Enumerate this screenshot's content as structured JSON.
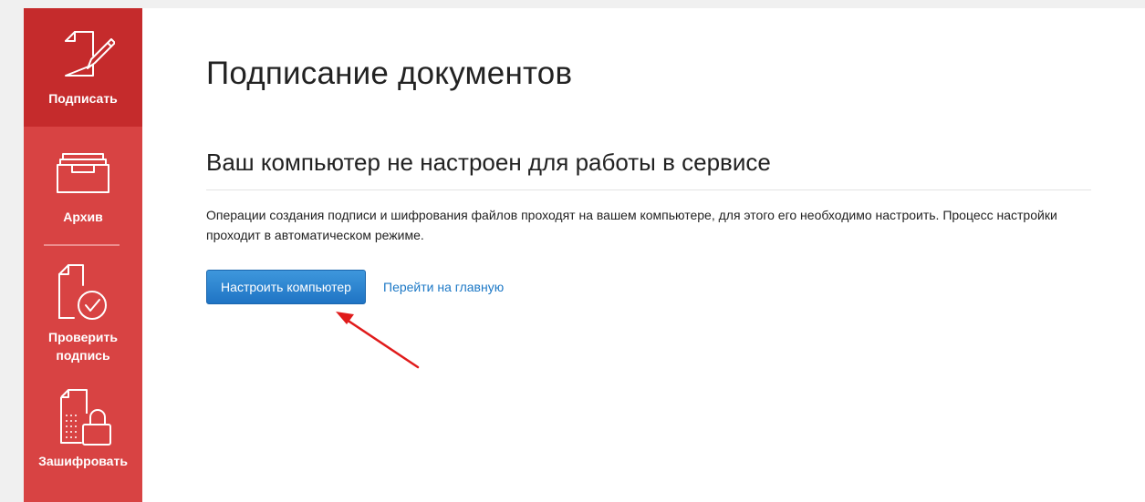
{
  "sidebar": {
    "items": [
      {
        "label": "Подписать",
        "icon": "sign-document-icon",
        "active": true
      },
      {
        "label": "Архив",
        "icon": "archive-tray-icon"
      },
      {
        "label": "Проверить подпись",
        "icon": "verify-signature-icon"
      },
      {
        "label": "Зашифровать",
        "icon": "encrypt-lock-icon"
      }
    ],
    "colors": {
      "background": "#d84343",
      "active": "#c52b2c"
    }
  },
  "main": {
    "title": "Подписание документов",
    "section_title": "Ваш компьютер не настроен для работы в сервисе",
    "description": "Операции создания подписи и шифрования файлов проходят на вашем компьютере, для этого его необходимо настроить. Процесс настройки проходит в автоматическом режиме.",
    "setup_button_label": "Настроить компьютер",
    "home_link_label": "Перейти на главную"
  },
  "annotation": {
    "type": "arrow",
    "color": "#e01b1b",
    "points_to": "setup-button"
  },
  "colors": {
    "button": "#2a83d2",
    "link": "#1c78c6"
  }
}
